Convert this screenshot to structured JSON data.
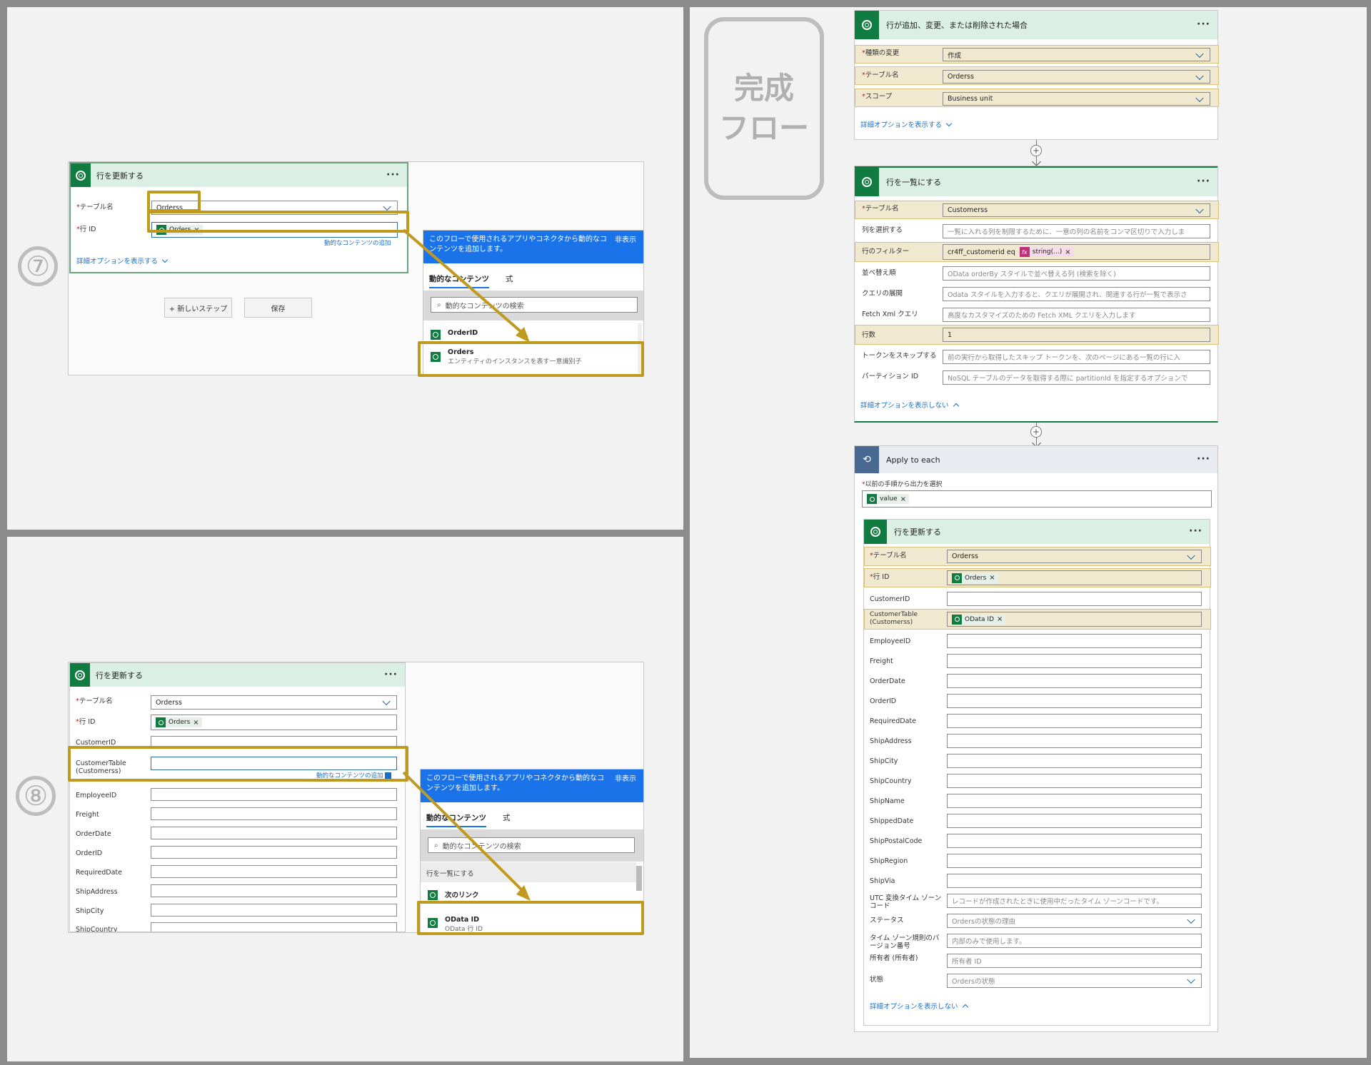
{
  "step7": {
    "number": "⑦",
    "card_title": "行を更新する",
    "table_label": "テーブル名",
    "table_value": "Orderss",
    "rowid_label": "行 ID",
    "rowid_token": "Orders",
    "dyn_link": "動的なコンテンツの追加",
    "advanced_link": "詳細オプションを表示する",
    "new_step_button": "+ 新しいステップ",
    "save_button": "保存",
    "dyn_panel": {
      "info": "このフローで使用されるアプリやコネクタから動的なコンテンツを追加します。",
      "hide": "非表示",
      "tab_dynamic": "動的なコンテンツ",
      "tab_expression": "式",
      "search_placeholder": "動的なコンテンツの検索",
      "items": [
        {
          "name": "OrderID",
          "desc": ""
        },
        {
          "name": "Orders",
          "desc": "エンティティのインスタンスを表す一意識別子"
        }
      ]
    }
  },
  "step8": {
    "number": "⑧",
    "card_title": "行を更新する",
    "table_label": "テーブル名",
    "table_value": "Orderss",
    "rowid_label": "行 ID",
    "rowid_token": "Orders",
    "fields": [
      "CustomerID",
      "CustomerTable (Customerss)",
      "EmployeeID",
      "Freight",
      "OrderDate",
      "OrderID",
      "RequiredDate",
      "ShipAddress",
      "ShipCity",
      "ShipCountry"
    ],
    "dyn_link": "動的なコンテンツの追加",
    "dyn_panel": {
      "info": "このフローで使用されるアプリやコネクタから動的なコンテンツを追加します。",
      "hide": "非表示",
      "tab_dynamic": "動的なコンテンツ",
      "tab_expression": "式",
      "search_placeholder": "動的なコンテンツの検索",
      "group": "行を一覧にする",
      "items": [
        {
          "name": "次のリンク",
          "desc": ""
        },
        {
          "name": "OData ID",
          "desc": "OData 行 ID"
        }
      ]
    }
  },
  "complete_flow": {
    "badge": "完成\nフロー",
    "trigger": {
      "title": "行が追加、変更、または削除された場合",
      "rows": [
        {
          "label": "種類の変更",
          "value": "作成"
        },
        {
          "label": "テーブル名",
          "value": "Orderss"
        },
        {
          "label": "スコープ",
          "value": "Business unit"
        }
      ],
      "advanced_link": "詳細オプションを表示する"
    },
    "list_rows": {
      "title": "行を一覧にする",
      "table_label": "テーブル名",
      "table_value": "Customerss",
      "select_label": "列を選択する",
      "select_ph": "一覧に入れる列を制限するために、一意の列の名前をコンマ区切りで入力しま",
      "filter_label": "行のフィルター",
      "filter_text": "cr4ff_customerid eq",
      "filter_token": "string(...)",
      "orderby_label": "並べ替え順",
      "orderby_ph": "OData orderBy スタイルで並べ替える列 (検索を除く)",
      "expand_label": "クエリの展開",
      "expand_ph": "Odata スタイルを入力すると、クエリが展開され、関連する行が一覧で表示さ",
      "fetch_label": "Fetch Xml クエリ",
      "fetch_ph": "高度なカスタマイズのための Fetch XML クエリを入力します",
      "count_label": "行数",
      "count_value": "1",
      "skip_label": "トークンをスキップする",
      "skip_ph": "前の実行から取得したスキップ トークンを、次のページにある一覧の行に入",
      "partition_label": "パーティション ID",
      "partition_ph": "NoSQL テーブルのデータを取得する際に partitionId を指定するオプションで",
      "advanced_hide": "詳細オプションを表示しない"
    },
    "apply_each": {
      "title": "Apply to each",
      "output_label": "以前の手順から出力を選択",
      "output_token": "value"
    },
    "update_row": {
      "title": "行を更新する",
      "table_label": "テーブル名",
      "table_value": "Orderss",
      "rowid_label": "行 ID",
      "rowid_token": "Orders",
      "customerid": "CustomerID",
      "customertable": "CustomerTable (Customerss)",
      "customertable_token": "OData ID",
      "fields": [
        "EmployeeID",
        "Freight",
        "OrderDate",
        "OrderID",
        "RequiredDate",
        "ShipAddress",
        "ShipCity",
        "ShipCountry",
        "ShipName",
        "ShippedDate",
        "ShipPostalCode",
        "ShipRegion",
        "ShipVia"
      ],
      "utc_label": "UTC 変換タイム ゾーン コード",
      "utc_ph": "レコードが作成されたときに使用中だったタイム ゾーンコードです。",
      "status_label": "ステータス",
      "status_ph": "Ordersの状態の理由",
      "tzver_label": "タイム ゾーン規則のバージョン番号",
      "tzver_ph": "内部のみで使用します。",
      "owner_label": "所有者 (所有者)",
      "owner_ph": "所有者 ID",
      "state_label": "状態",
      "state_ph": "Ordersの状態",
      "advanced_hide": "詳細オプションを表示しない"
    }
  },
  "colors": {
    "highlight": "#c09a1e",
    "dataverse_green": "#107c41",
    "dyn_blue": "#1a73e8"
  }
}
